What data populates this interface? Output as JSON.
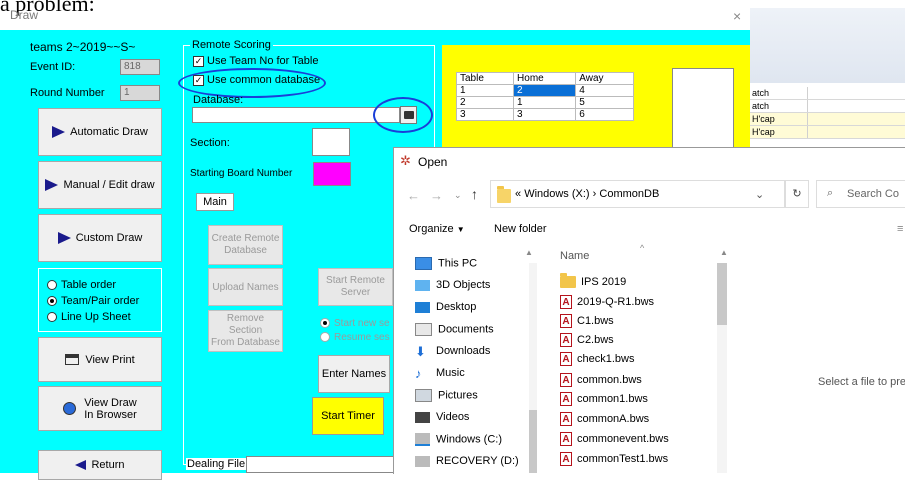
{
  "background_text": "a problem:",
  "window": {
    "title": "Draw",
    "close_glyph": "×"
  },
  "left": {
    "event_title": "teams 2~2019~~S~",
    "event_id_label": "Event ID:",
    "event_id_value": "818",
    "round_label": "Round Number",
    "round_value": "1",
    "buttons": {
      "automatic": "Automatic Draw",
      "manual": "Manual / Edit draw",
      "custom": "Custom Draw",
      "view_print": "View Print",
      "view_draw_line1": "View Draw",
      "view_draw_line2": "In Browser",
      "return": "Return"
    },
    "order_options": [
      "Table order",
      "Team/Pair order",
      "Line Up Sheet"
    ],
    "order_selected": "Team/Pair order"
  },
  "remote": {
    "group_title": "Remote Scoring",
    "use_team_no": "Use Team No for Table",
    "use_common_db": "Use common database",
    "database_label": "Database:",
    "section_label": "Section:",
    "starting_board_label": "Starting Board Number",
    "main_tab": "Main",
    "create_db_l1": "Create Remote",
    "create_db_l2": "Database",
    "upload_names": "Upload Names",
    "start_remote_l1": "Start Remote",
    "start_remote_l2": "Server",
    "remove_section_l1": "Remove Section",
    "remove_section_l2": "From Database",
    "start_new_session": "Start new se",
    "resume_session": "Resume ses",
    "enter_names": "Enter Names",
    "start_timer": "Start Timer",
    "dealing_file_label": "Dealing File:"
  },
  "draw_table": {
    "headers": [
      "Table",
      "Home",
      "Away"
    ],
    "rows": [
      [
        "1",
        "2",
        "4"
      ],
      [
        "2",
        "1",
        "5"
      ],
      [
        "3",
        "3",
        "6"
      ]
    ]
  },
  "right_rows": [
    "atch",
    "atch",
    "H'cap",
    "H'cap"
  ],
  "open_dialog": {
    "title": "Open",
    "path": [
      "«",
      "Windows (X:)",
      "›",
      "CommonDB"
    ],
    "search_placeholder": "Search Co",
    "organize": "Organize",
    "new_folder": "New folder",
    "column_name": "Name",
    "nav_items": [
      {
        "label": "This PC",
        "icon": "pc-icon"
      },
      {
        "label": "3D Objects",
        "icon": "3d-objects-icon"
      },
      {
        "label": "Desktop",
        "icon": "desktop-icon"
      },
      {
        "label": "Documents",
        "icon": "documents-icon"
      },
      {
        "label": "Downloads",
        "icon": "downloads-icon"
      },
      {
        "label": "Music",
        "icon": "music-icon"
      },
      {
        "label": "Pictures",
        "icon": "pictures-icon"
      },
      {
        "label": "Videos",
        "icon": "videos-icon"
      },
      {
        "label": "Windows (C:)",
        "icon": "drive-icon"
      },
      {
        "label": "RECOVERY (D:)",
        "icon": "drive-icon"
      }
    ],
    "files": [
      {
        "name": "IPS 2019",
        "type": "folder"
      },
      {
        "name": "2019-Q-R1.bws",
        "type": "file"
      },
      {
        "name": "C1.bws",
        "type": "file"
      },
      {
        "name": "C2.bws",
        "type": "file"
      },
      {
        "name": "check1.bws",
        "type": "file"
      },
      {
        "name": "common.bws",
        "type": "file"
      },
      {
        "name": "common1.bws",
        "type": "file"
      },
      {
        "name": "commonA.bws",
        "type": "file"
      },
      {
        "name": "commonevent.bws",
        "type": "file"
      },
      {
        "name": "commonTest1.bws",
        "type": "file"
      }
    ],
    "preview_text": "Select a file to pre"
  },
  "colors": {
    "dialog_bg": "#00ffff",
    "yellow": "#ffff00",
    "magenta": "#ff00ff",
    "annotation": "#1a3fd8",
    "selection": "#0a6fd6"
  }
}
